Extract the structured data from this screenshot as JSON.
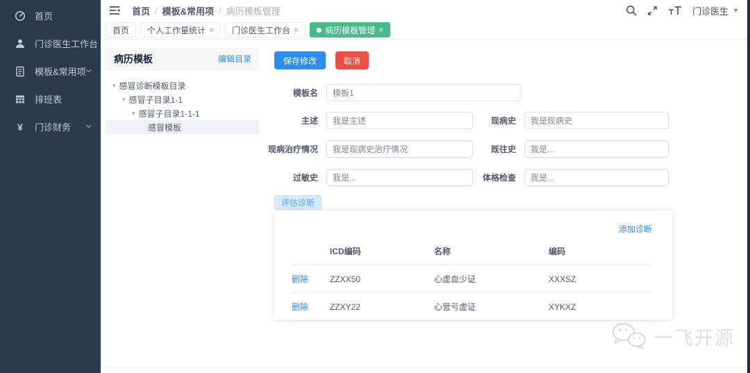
{
  "sidebar": {
    "items": [
      {
        "label": "首页",
        "icon": "dashboard-icon",
        "expandable": false
      },
      {
        "label": "门诊医生工作台",
        "icon": "user-icon",
        "expandable": false
      },
      {
        "label": "模板&常用项",
        "icon": "list-icon",
        "expandable": true
      },
      {
        "label": "排班表",
        "icon": "table-icon",
        "expandable": false
      },
      {
        "label": "门诊财务",
        "icon": "money-icon",
        "expandable": true
      }
    ],
    "money_glyph": "¥"
  },
  "topbar": {
    "breadcrumb": [
      "首页",
      "模板&常用项",
      "病历模板管理"
    ],
    "icons": [
      "collapse-menu-icon",
      "search-icon",
      "fullscreen-icon",
      "font-size-icon"
    ],
    "user": "门诊医生",
    "user_caret": "▼"
  },
  "tabs": [
    {
      "label": "首页",
      "closable": false,
      "active": false
    },
    {
      "label": "个人工作量统计",
      "closable": true,
      "active": false
    },
    {
      "label": "门诊医生工作台",
      "closable": true,
      "active": false
    },
    {
      "label": "病历模板管理",
      "closable": true,
      "active": true
    }
  ],
  "glyphs": {
    "close": "×",
    "tree_caret": "▾"
  },
  "panel": {
    "title": "病历模板",
    "edit_link": "编辑目录",
    "tree": [
      {
        "label": "感冒诊断模板目录",
        "depth": 0,
        "selected": false
      },
      {
        "label": "感冒子目录1-1",
        "depth": 1,
        "selected": false
      },
      {
        "label": "感冒子目录1-1-1",
        "depth": 2,
        "selected": false
      },
      {
        "label": "感冒模板",
        "depth": 3,
        "selected": true
      }
    ]
  },
  "form": {
    "save_label": "保存修改",
    "cancel_label": "取消",
    "template_name": {
      "label": "模板名",
      "value": "模板1"
    },
    "chief_complaint": {
      "label": "主述",
      "value": "我是主述"
    },
    "present_illness": {
      "label": "现病史",
      "value": "我是现病史"
    },
    "treatment_status": {
      "label": "现病治疗情况",
      "value": "我是现病史治疗情况"
    },
    "past_history": {
      "label": "既往史",
      "value": "我是..."
    },
    "allergy_history": {
      "label": "过敏史",
      "value": "我是..."
    },
    "physical_exam": {
      "label": "体格检查",
      "value": "我是..."
    }
  },
  "diagnosis": {
    "tab_label": "评估诊断",
    "add_link": "添加诊断",
    "columns": {
      "action": "",
      "icd": "ICD编码",
      "name": "名称",
      "code": "编码"
    },
    "rows": [
      {
        "action": "删除",
        "icd": "ZZXX50",
        "name": "心虚血少证",
        "code": "XXXSZ"
      },
      {
        "action": "删除",
        "icd": "ZZXY22",
        "name": "心营亏虚证",
        "code": "XYKXZ"
      }
    ]
  },
  "watermark": {
    "text": "一飞开源",
    "icon": "wechat-bubbles-icon"
  },
  "colors": {
    "sidebar_bg": "#2d3a4b",
    "sidebar_text": "#bfcbd9",
    "primary_blue": "#2d8cf0",
    "danger_red": "#ee4e44",
    "active_tab_green": "#47ba87",
    "diag_badge_bg": "#d9eafc",
    "diag_badge_text": "#57a3f3"
  }
}
